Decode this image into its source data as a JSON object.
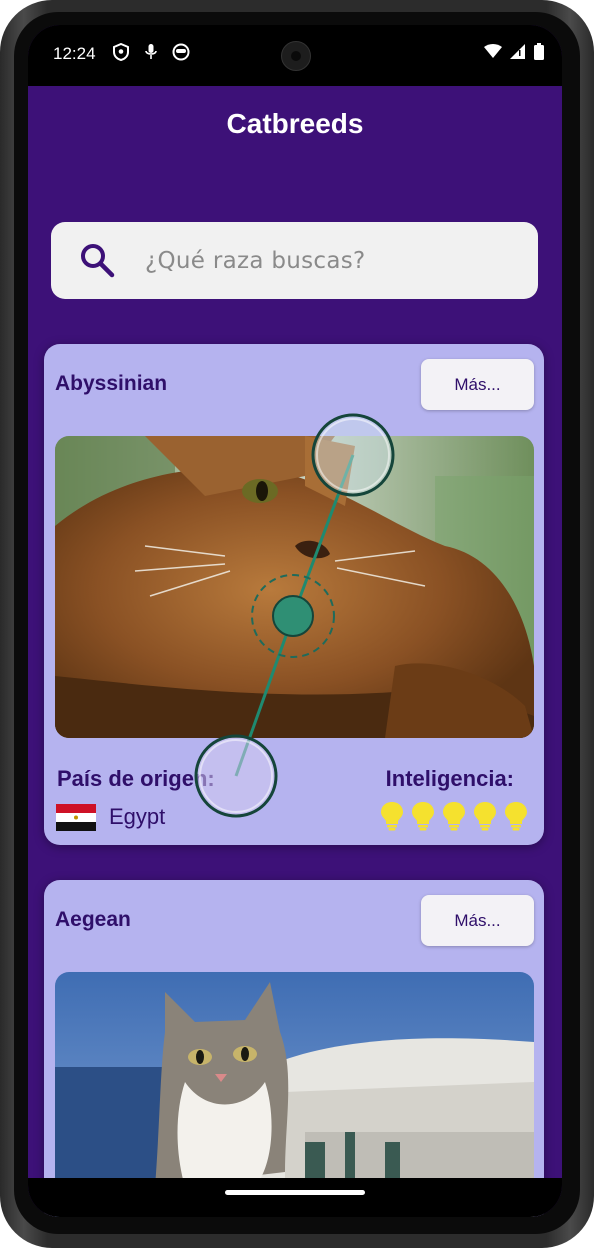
{
  "status_bar": {
    "time": "12:24",
    "left_icons": [
      "shield-icon",
      "mic-icon",
      "face-icon"
    ],
    "right_icons": [
      "wifi-icon",
      "signal-icon",
      "battery-icon"
    ]
  },
  "app": {
    "title": "Catbreeds"
  },
  "search": {
    "placeholder": "¿Qué raza buscas?",
    "value": "",
    "icon": "search-icon"
  },
  "breeds": [
    {
      "name": "Abyssinian",
      "more_label": "Más...",
      "country_label": "País de origen:",
      "country": "Egypt",
      "intelligence_label": "Inteligencia:",
      "intelligence": 5,
      "intelligence_max": 5
    },
    {
      "name": "Aegean",
      "more_label": "Más..."
    }
  ],
  "colors": {
    "background": "#3d1178",
    "card": "#b5b3ef",
    "text_primary": "#2f0f6a",
    "bulb": "#f5e12e",
    "overlay_accent": "#1f8a70"
  }
}
